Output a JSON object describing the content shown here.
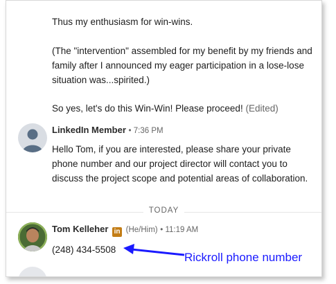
{
  "messages": {
    "first": {
      "line1": "Thus my enthusiasm for win-wins.",
      "paragraph2": "(The \"intervention\" assembled for my benefit by my friends and family after I announced my eager participation in a lose-lose situation was...spirited.)",
      "line3": "So yes, let's do this Win-Win! Please proceed!",
      "edited": "(Edited)"
    },
    "second": {
      "sender": "LinkedIn Member",
      "time": "• 7:36 PM",
      "body": "Hello Tom, if you are interested, please share your private phone number and our project director will contact you to discuss the project scope and potential areas of collaboration."
    },
    "divider": "TODAY",
    "third": {
      "sender": "Tom Kelleher",
      "badge": "in",
      "pronouns": "(He/Him)",
      "time": "• 11:19 AM",
      "body": "(248) 434-5508"
    }
  },
  "annotation": {
    "text": "Rickroll phone number",
    "color": "#1a1aff"
  },
  "icons": {
    "default_avatar": "person-silhouette-icon",
    "linkedin_badge": "linkedin-icon",
    "arrow": "arrow-left-icon"
  }
}
